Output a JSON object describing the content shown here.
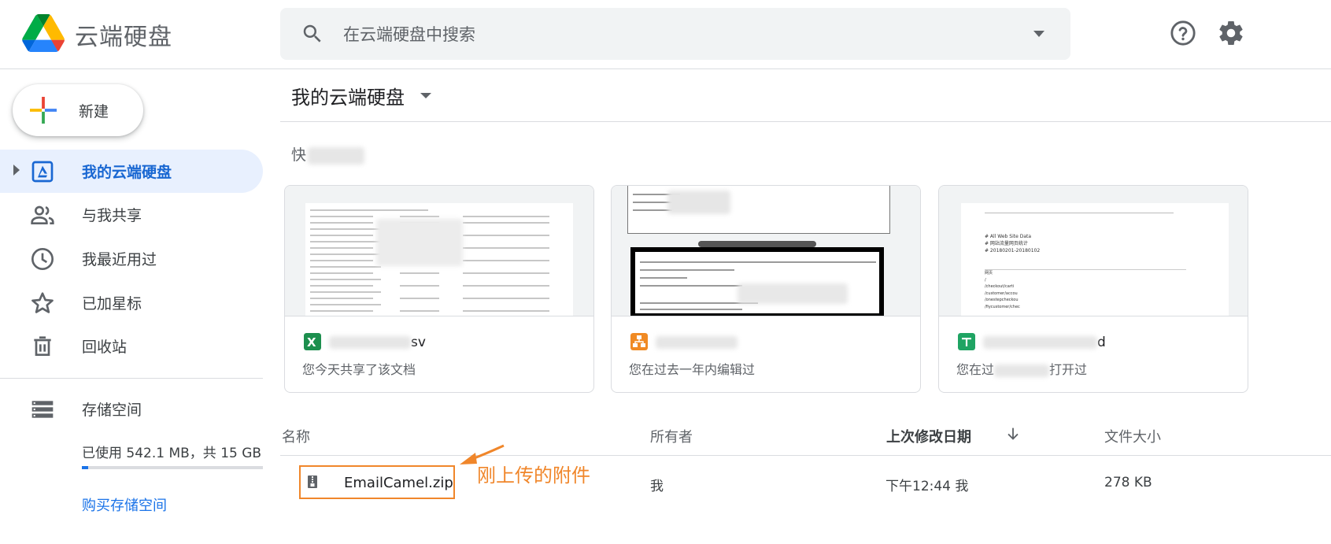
{
  "header": {
    "app_title": "云端硬盘",
    "search_placeholder": "在云端硬盘中搜索"
  },
  "sidebar": {
    "new_label": "新建",
    "items": [
      {
        "label": "我的云端硬盘",
        "icon": "drive-folder-icon",
        "active": true
      },
      {
        "label": "与我共享",
        "icon": "people-icon",
        "active": false
      },
      {
        "label": "我最近用过",
        "icon": "clock-icon",
        "active": false
      },
      {
        "label": "已加星标",
        "icon": "star-icon",
        "active": false
      },
      {
        "label": "回收站",
        "icon": "trash-icon",
        "active": false
      },
      {
        "label": "存储空间",
        "icon": "storage-icon",
        "active": false
      }
    ],
    "storage_text": "已使用 542.1 MB，共 15 GB",
    "storage_used_fraction": 0.035,
    "buy_storage": "购买存储空间"
  },
  "main": {
    "title": "我的云端硬盘",
    "quick_access_prefix": "快",
    "cards": [
      {
        "name_suffix": "sv",
        "subtitle": "您今天共享了该文档",
        "icon": "excel-icon",
        "icon_color": "#1d8f4e"
      },
      {
        "name_suffix": "",
        "subtitle": "您在过去一年内编辑过",
        "icon": "diagram-icon",
        "icon_color": "#f08a24"
      },
      {
        "name_suffix": "d",
        "subtitle_prefix": "您在过",
        "subtitle_suffix": "打开过",
        "icon": "sheets-icon",
        "icon_color": "#1fa463"
      }
    ],
    "sheet_preview": [
      "# All Web Site Data",
      "# 网站流量网页统计",
      "# 20180201-20180102",
      "网页",
      "/",
      "/checkout/carti",
      "/customer/accou",
      "/onestepcheckou",
      "/fiycustomer/chec"
    ],
    "list": {
      "columns": [
        "名称",
        "所有者",
        "上次修改日期",
        "文件大小"
      ],
      "rows": [
        {
          "name": "EmailCamel.zip",
          "owner": "我",
          "modified": "下午12:44 我",
          "size": "278 KB"
        }
      ]
    },
    "annotation": "刚上传的附件"
  },
  "colors": {
    "accent": "#1a73e8",
    "active_bg": "#e8f0fe",
    "annotation": "#f0862a"
  }
}
